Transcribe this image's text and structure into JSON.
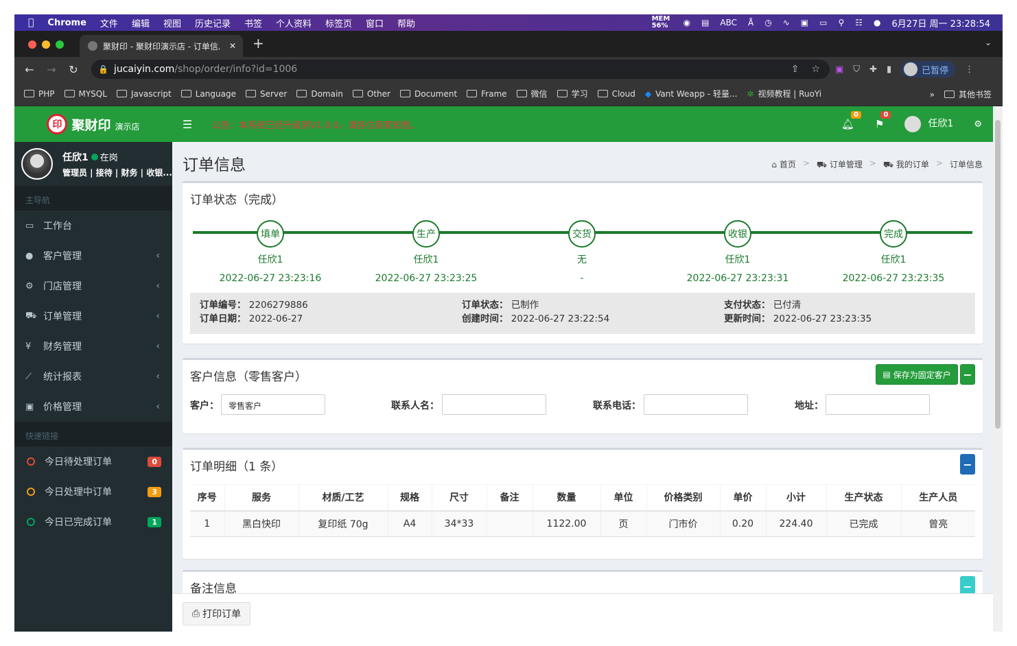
{
  "menubar": {
    "app": "Chrome",
    "items": [
      "文件",
      "编辑",
      "视图",
      "历史记录",
      "书签",
      "个人资料",
      "标签页",
      "窗口",
      "帮助"
    ],
    "mem": "MEM 56%",
    "input": "ABC",
    "datetime": "6月27日 周一 23:28:54"
  },
  "browser": {
    "tab_title": "聚财印 - 聚财印演示店 - 订单信息",
    "url_host": "jucaiyin.com",
    "url_path": "/shop/order/info?id=1006",
    "paused_label": "已暂停",
    "bookmarks": [
      "PHP",
      "MYSQL",
      "Javascript",
      "Language",
      "Server",
      "Domain",
      "Other",
      "Document",
      "Frame",
      "微信",
      "学习",
      "Cloud",
      "Vant Weapp - 轻量...",
      "视频教程 | RuoYi"
    ],
    "bookmarks_more": "»",
    "other_bookmarks": "其他书签"
  },
  "sidebar": {
    "logo_name": "聚财印",
    "logo_sub": "演示店",
    "user_name": "任欣1",
    "user_status": "在岗",
    "user_roles": "管理员 | 接待 | 财务 | 收银...",
    "main_nav_header": "主导航",
    "main_nav": [
      {
        "label": "工作台",
        "icon": "desktop-icon",
        "has_children": false
      },
      {
        "label": "客户管理",
        "icon": "user-icon",
        "has_children": true
      },
      {
        "label": "门店管理",
        "icon": "cogs-icon",
        "has_children": true
      },
      {
        "label": "订单管理",
        "icon": "cart-icon",
        "has_children": true
      },
      {
        "label": "财务管理",
        "icon": "yen-icon",
        "has_children": true
      },
      {
        "label": "统计报表",
        "icon": "chart-icon",
        "has_children": true
      },
      {
        "label": "价格管理",
        "icon": "money-icon",
        "has_children": true
      }
    ],
    "quick_header": "快速链接",
    "quick_links": [
      {
        "label": "今日待处理订单",
        "count": "0",
        "color": "#dd4b39"
      },
      {
        "label": "今日处理中订单",
        "count": "3",
        "color": "#f39c12"
      },
      {
        "label": "今日已完成订单",
        "count": "1",
        "color": "#00a65a"
      }
    ]
  },
  "header": {
    "notice": "公告：本系统已经升级到V1.0.0，请各位商家知悉。",
    "bell_count": "0",
    "flag_count": "0",
    "user": "任欣1"
  },
  "page": {
    "title": "订单信息",
    "breadcrumb": [
      "首页",
      "订单管理",
      "我的订单",
      "订单信息"
    ]
  },
  "status_box": {
    "title": "订单状态（完成）",
    "steps": [
      {
        "name": "填单",
        "person": "任欣1",
        "time": "2022-06-27 23:23:16"
      },
      {
        "name": "生产",
        "person": "任欣1",
        "time": "2022-06-27 23:23:25"
      },
      {
        "name": "交货",
        "person": "无",
        "time": "-"
      },
      {
        "name": "收银",
        "person": "任欣1",
        "time": "2022-06-27 23:23:31"
      },
      {
        "name": "完成",
        "person": "任欣1",
        "time": "2022-06-27 23:23:35"
      }
    ],
    "info": {
      "order_no_label": "订单编号：",
      "order_no": "2206279886",
      "order_date_label": "订单日期：",
      "order_date": "2022-06-27",
      "order_status_label": "订单状态：",
      "order_status": "已制作",
      "created_label": "创建时间：",
      "created": "2022-06-27 23:22:54",
      "pay_status_label": "支付状态：",
      "pay_status": "已付清",
      "updated_label": "更新时间：",
      "updated": "2022-06-27 23:23:35"
    }
  },
  "customer_box": {
    "title": "客户信息（零售客户）",
    "save_button": "保存为固定客户",
    "collapse": "−",
    "customer_label": "客户：",
    "customer_value": "零售客户",
    "contact_label": "联系人名：",
    "contact_value": "",
    "phone_label": "联系电话：",
    "phone_value": "",
    "address_label": "地址：",
    "address_value": ""
  },
  "detail_box": {
    "title": "订单明细（1 条）",
    "collapse": "−",
    "columns": [
      "序号",
      "服务",
      "材质/工艺",
      "规格",
      "尺寸",
      "备注",
      "数量",
      "单位",
      "价格类别",
      "单价",
      "小计",
      "生产状态",
      "生产人员"
    ],
    "rows": [
      [
        "1",
        "黑白快印",
        "复印纸 70g",
        "A4",
        "34*33",
        "",
        "1122.00",
        "页",
        "门市价",
        "0.20",
        "224.40",
        "已完成",
        "曾亮"
      ]
    ]
  },
  "remark_box": {
    "title": "备注信息",
    "collapse": "−"
  },
  "print_button": "打印订单"
}
